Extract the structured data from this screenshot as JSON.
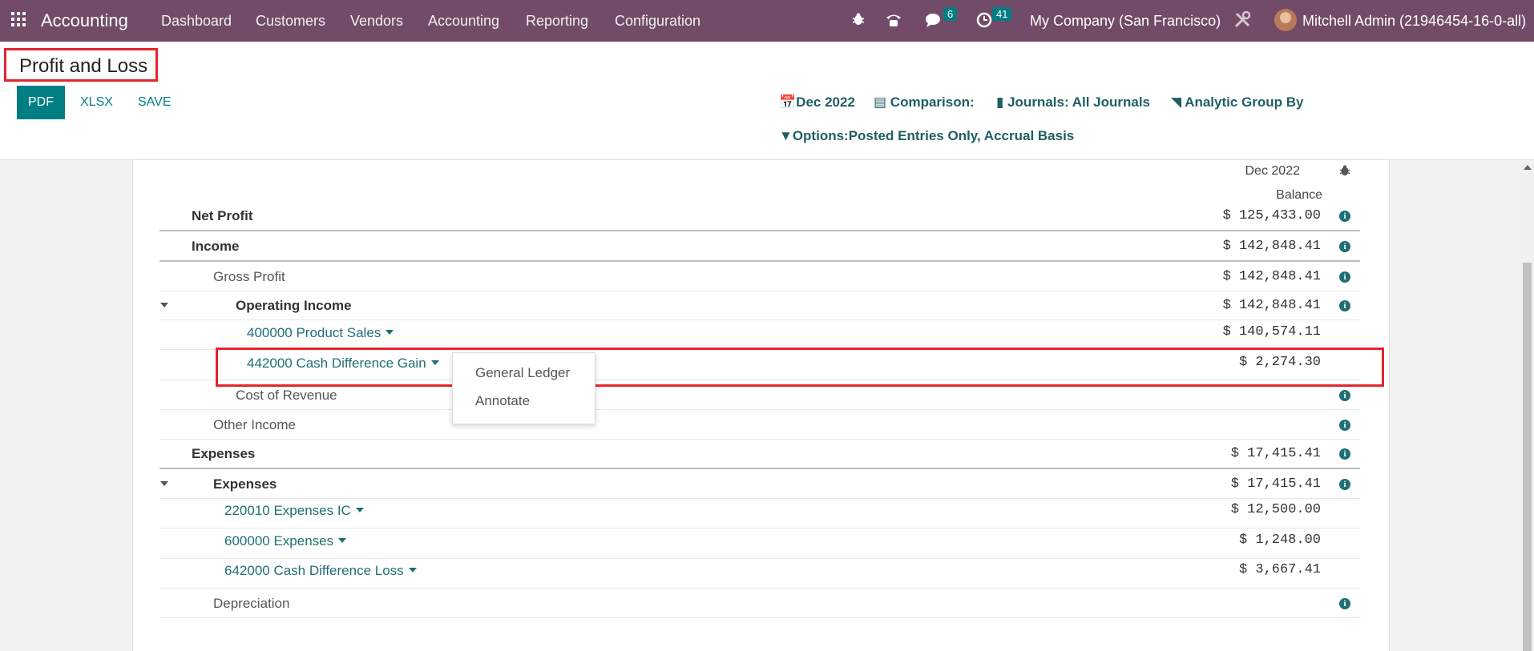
{
  "navbar": {
    "app_name": "Accounting",
    "menu": [
      "Dashboard",
      "Customers",
      "Vendors",
      "Accounting",
      "Reporting",
      "Configuration"
    ],
    "messages_count": "6",
    "activities_count": "41",
    "company": "My Company (San Francisco)",
    "user": "Mitchell Admin (21946454-16-0-all)"
  },
  "control_panel": {
    "title": "Profit and Loss",
    "buttons": {
      "pdf": "PDF",
      "xlsx": "XLSX",
      "save": "SAVE"
    },
    "filters": {
      "date": "Dec 2022",
      "comparison": "Comparison:",
      "journals": "Journals: All Journals",
      "analytic": "Analytic Group By",
      "options": "Options:Posted Entries Only, Accrual Basis"
    }
  },
  "report": {
    "column_period": "Dec 2022",
    "column_balance": "Balance",
    "rows": [
      {
        "label": "Net Profit",
        "amount": "$ 125,433.00"
      },
      {
        "label": "Income",
        "amount": "$ 142,848.41"
      },
      {
        "label": "Gross Profit",
        "amount": "$ 142,848.41"
      },
      {
        "label": "Operating Income",
        "amount": "$ 142,848.41"
      },
      {
        "label": "400000 Product Sales",
        "amount": "$ 140,574.11"
      },
      {
        "label": "442000 Cash Difference Gain",
        "amount": "$ 2,274.30"
      },
      {
        "label": "Cost of Revenue",
        "amount": ""
      },
      {
        "label": "Other Income",
        "amount": ""
      },
      {
        "label": "Expenses",
        "amount": "$ 17,415.41"
      },
      {
        "label": "Expenses",
        "amount": "$ 17,415.41"
      },
      {
        "label": "220010 Expenses IC",
        "amount": "$ 12,500.00"
      },
      {
        "label": "600000 Expenses",
        "amount": "$ 1,248.00"
      },
      {
        "label": "642000 Cash Difference Loss",
        "amount": "$ 3,667.41"
      },
      {
        "label": "Depreciation",
        "amount": ""
      }
    ]
  },
  "dropdown": {
    "items": [
      "General Ledger",
      "Annotate"
    ]
  },
  "colors": {
    "navbar": "#714b67",
    "primary": "#017e84",
    "highlight": "#e3252f"
  }
}
